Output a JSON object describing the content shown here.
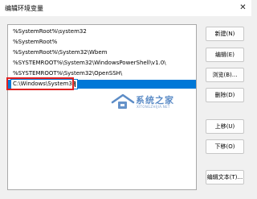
{
  "window": {
    "title": "编辑环境变量",
    "close_glyph": "✕"
  },
  "paths": [
    "%SystemRoot%\\system32",
    "%SystemRoot%",
    "%SystemRoot%\\System32\\Wbem",
    "%SYSTEMROOT%\\System32\\WindowsPowerShell\\v1.0\\",
    "%SYSTEMROOT%\\System32\\OpenSSH\\"
  ],
  "editing_value": "C:\\Windows\\System32",
  "buttons": {
    "new": "新建(N)",
    "edit": "编辑(E)",
    "browse": "浏览(B)...",
    "delete": "删除(D)",
    "move_up": "上移(U)",
    "move_down": "下移(O)",
    "edit_text": "编辑文本(T)..."
  },
  "watermark": {
    "name": "系统之家",
    "url": "XITONGZHIJIA.NET"
  },
  "colors": {
    "selection": "#0078d7",
    "highlight": "#e02020"
  }
}
